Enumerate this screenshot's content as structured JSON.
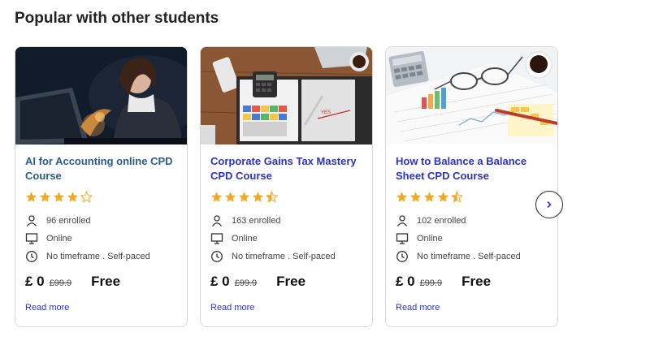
{
  "section": {
    "title": "Popular with other students"
  },
  "cards": [
    {
      "title": "AI for Accounting online CPD Course",
      "title_color": "#2a5d8f",
      "rating": 4,
      "enrolled": "96 enrolled",
      "mode": "Online",
      "schedule": "No timeframe . Self-paced",
      "price": "£ 0",
      "old_price": "£99.9",
      "free_label": "Free",
      "read_more": "Read more"
    },
    {
      "title": "Corporate Gains Tax Mastery CPD Course",
      "title_color": "#2b32c8",
      "rating": 4.5,
      "enrolled": "163 enrolled",
      "mode": "Online",
      "schedule": "No timeframe . Self-paced",
      "price": "£ 0",
      "old_price": "£99.9",
      "free_label": "Free",
      "read_more": "Read more"
    },
    {
      "title": "How to Balance a Balance Sheet CPD Course",
      "title_color": "#2b32c8",
      "rating": 4.5,
      "enrolled": "102 enrolled",
      "mode": "Online",
      "schedule": "No timeframe . Self-paced",
      "price": "£ 0",
      "old_price": "£99.9",
      "free_label": "Free",
      "read_more": "Read more"
    }
  ],
  "icons": {
    "enrolled": "person-icon",
    "mode": "monitor-icon",
    "schedule": "clock-icon",
    "next": "chevron-right-icon"
  },
  "colors": {
    "star": "#f5a623",
    "link": "#2b32c8"
  }
}
